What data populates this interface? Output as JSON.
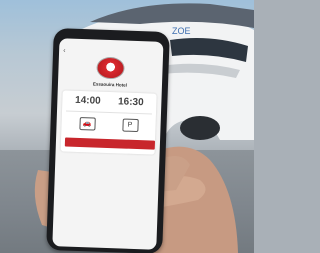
{
  "colors": {
    "accent": "#c8262c",
    "phone_body": "#1b1c1f",
    "screen_bg": "#f4f4f4"
  },
  "status_bar": {
    "time": "",
    "icons": ""
  },
  "app": {
    "back_icon": "back-arrow-icon",
    "hotel_name": "Essaouira Hotel",
    "hotel_address": "",
    "checkin_time": "14:00",
    "checkout_time": "16:30",
    "checkin_caption": "",
    "checkout_caption": "",
    "actions": [
      {
        "icon": "car-icon",
        "label": ""
      },
      {
        "icon": "parking-icon",
        "label": ""
      }
    ],
    "cancel_label": "",
    "info_label": "",
    "info_value": "",
    "footer": ""
  }
}
